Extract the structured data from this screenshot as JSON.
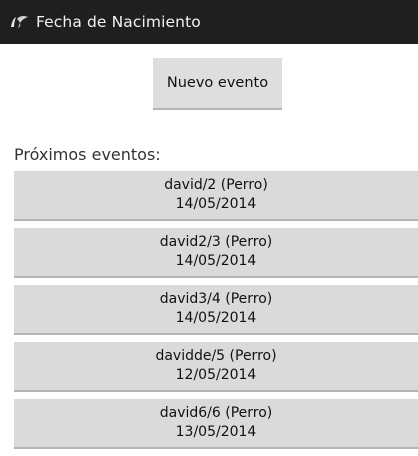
{
  "app": {
    "title": "Fecha de Nacimiento",
    "icon": "app-logo-icon"
  },
  "actions": {
    "new_event_label": "Nuevo evento"
  },
  "events_section": {
    "label": "Próximos eventos:",
    "items": [
      {
        "name": "david/2 (Perro)",
        "date": "14/05/2014"
      },
      {
        "name": "david2/3 (Perro)",
        "date": "14/05/2014"
      },
      {
        "name": "david3/4 (Perro)",
        "date": "14/05/2014"
      },
      {
        "name": "davidde/5 (Perro)",
        "date": "12/05/2014"
      },
      {
        "name": "david6/6 (Perro)",
        "date": "13/05/2014"
      }
    ]
  },
  "colors": {
    "action_bar": "#1f1f1f",
    "button_bg": "#dadada"
  }
}
